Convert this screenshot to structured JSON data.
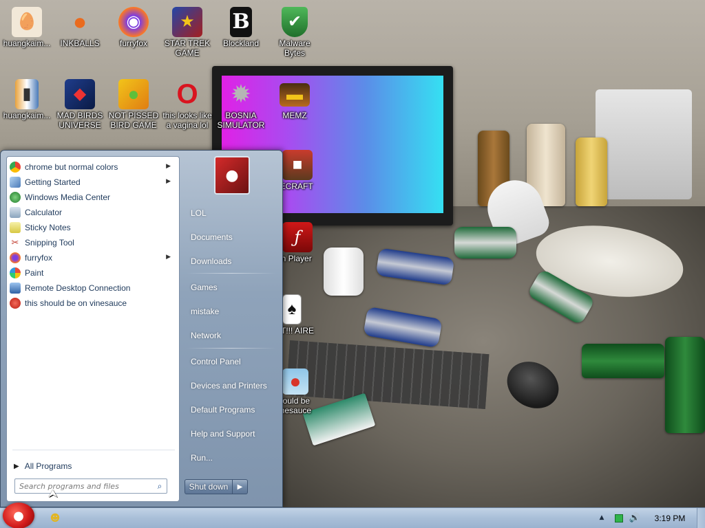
{
  "desktop": {
    "icons": [
      {
        "label": "huangkaim...",
        "glyph": "🥚",
        "color": "#f2e8d8"
      },
      {
        "label": "INKBALLS",
        "glyph": "●",
        "color": "#ea6b1e"
      },
      {
        "label": "furryfox",
        "glyph": "◉",
        "color": "#ff7a1f"
      },
      {
        "label": "STAR TREK GAME",
        "glyph": "★",
        "color": "#2346a8"
      },
      {
        "label": "Blockland",
        "glyph": "B",
        "color": "#111111"
      },
      {
        "label": "Malware Bytes",
        "glyph": "✔",
        "color": "#2f8f39"
      },
      {
        "label": "huangkaim...",
        "glyph": "▮",
        "color": "#e8a23c"
      },
      {
        "label": "MAD BIRDS UNIVERSE",
        "glyph": "◆",
        "color": "#1f3d8c"
      },
      {
        "label": "NOT PISSED BIRD GAME",
        "glyph": "●",
        "color": "#f2c41a"
      },
      {
        "label": "this looks like a vagina lol",
        "glyph": "O",
        "color": "#d9141f"
      },
      {
        "label": "BOSNIA SIMULATOR",
        "glyph": "✹",
        "color": "#9a9a9a"
      },
      {
        "label": "MEMZ",
        "glyph": "▬",
        "color": "#b86a1e"
      },
      {
        "label": "MINECRAFT",
        "glyph": "■",
        "color": "#c93b2d"
      },
      {
        "label": "Flash Player",
        "glyph": "ƒ",
        "color": "#b01010"
      },
      {
        "label": "LIT!!! AIRE",
        "glyph": "♠",
        "color": "#ffffff"
      },
      {
        "label": "this should be on vinesauce",
        "glyph": "●",
        "color": "#d8352a"
      }
    ],
    "visible_labels": {
      "minecraft": "NECRAFT",
      "flash": "orn Player",
      "lit": "LIT!!! AIRE",
      "vinesauce": "should be vinesauce"
    }
  },
  "start_menu": {
    "programs": [
      {
        "label": "chrome but normal colors",
        "icon": "chrome-icon",
        "color": "#4285f4",
        "has_submenu": true
      },
      {
        "label": "Getting Started",
        "icon": "getting-started-icon",
        "color": "#7aa8d9",
        "has_submenu": true
      },
      {
        "label": "Windows Media Center",
        "icon": "media-center-icon",
        "color": "#2f9c3e",
        "has_submenu": false
      },
      {
        "label": "Calculator",
        "icon": "calculator-icon",
        "color": "#8aa4bd",
        "has_submenu": false
      },
      {
        "label": "Sticky Notes",
        "icon": "sticky-notes-icon",
        "color": "#e8e070",
        "has_submenu": false
      },
      {
        "label": "Snipping Tool",
        "icon": "snipping-tool-icon",
        "color": "#6f8fb5",
        "has_submenu": false
      },
      {
        "label": "furryfox",
        "icon": "furryfox-icon",
        "color": "#ff7a1f",
        "has_submenu": true
      },
      {
        "label": "Paint",
        "icon": "paint-icon",
        "color": "#e2b84c",
        "has_submenu": false
      },
      {
        "label": "Remote Desktop Connection",
        "icon": "remote-desktop-icon",
        "color": "#4a7ab8",
        "has_submenu": false
      },
      {
        "label": "this should be on vinesauce",
        "icon": "angry-bird-icon",
        "color": "#d8352a",
        "has_submenu": false
      }
    ],
    "all_programs_label": "All Programs",
    "search": {
      "placeholder": "Search programs and files",
      "value": ""
    },
    "places": [
      {
        "label": "LOL",
        "name": "place-lol"
      },
      {
        "label": "Documents",
        "name": "place-documents"
      },
      {
        "label": "Downloads",
        "name": "place-downloads"
      },
      {
        "label": "Games",
        "name": "place-games"
      },
      {
        "label": "mistake",
        "name": "place-mistake"
      },
      {
        "label": "Network",
        "name": "place-network"
      },
      {
        "label": "Control Panel",
        "name": "place-control-panel"
      },
      {
        "label": "Devices and Printers",
        "name": "place-devices-printers"
      },
      {
        "label": "Default Programs",
        "name": "place-default-programs"
      },
      {
        "label": "Help and Support",
        "name": "place-help-support"
      },
      {
        "label": "Run...",
        "name": "place-run"
      }
    ],
    "shutdown_label": "Shut down",
    "shutdown_options_glyph": "▶"
  },
  "taskbar": {
    "clock": "3:19 PM",
    "tray_arrow_glyph": "▲",
    "volume_glyph": "🔊",
    "start_glyph": "●",
    "app_glyph": "☻"
  },
  "colors": {
    "menu_text": "#1e395b",
    "taskbar": "#a9bfd8",
    "accent": "#d11b1b"
  }
}
